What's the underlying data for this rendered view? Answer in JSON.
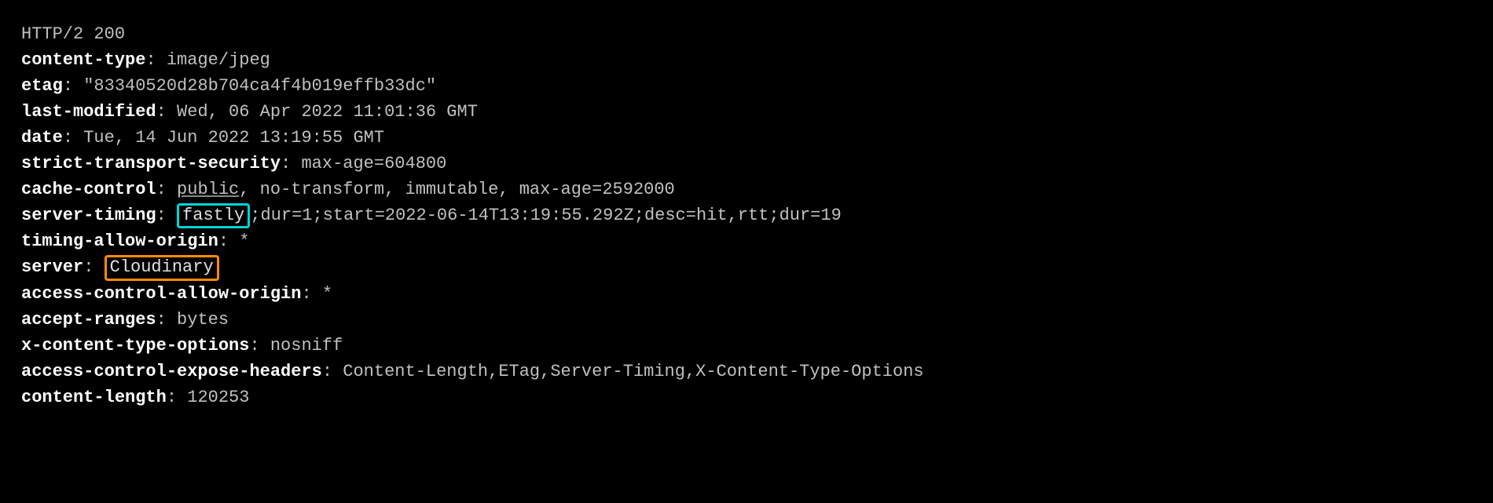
{
  "status_line": "HTTP/2 200",
  "headers": {
    "content_type": {
      "name": "content-type",
      "value": "image/jpeg"
    },
    "etag": {
      "name": "etag",
      "value": "\"83340520d28b704ca4f4b019effb33dc\""
    },
    "last_modified": {
      "name": "last-modified",
      "value": "Wed, 06 Apr 2022 11:01:36 GMT"
    },
    "date": {
      "name": "date",
      "value": "Tue, 14 Jun 2022 13:19:55 GMT"
    },
    "strict_transport_security": {
      "name": "strict-transport-security",
      "value": "max-age=604800"
    },
    "cache_control": {
      "name": "cache-control",
      "value_prefix": "public",
      "value_rest": ", no-transform, immutable, max-age=2592000"
    },
    "server_timing": {
      "name": "server-timing",
      "highlighted": "fastly",
      "value_rest": ";dur=1;start=2022-06-14T13:19:55.292Z;desc=hit,rtt;dur=19"
    },
    "timing_allow_origin": {
      "name": "timing-allow-origin",
      "value": "*"
    },
    "server": {
      "name": "server",
      "highlighted": "Cloudinary"
    },
    "access_control_allow_origin": {
      "name": "access-control-allow-origin",
      "value": "*"
    },
    "accept_ranges": {
      "name": "accept-ranges",
      "value": "bytes"
    },
    "x_content_type_options": {
      "name": "x-content-type-options",
      "value": "nosniff"
    },
    "access_control_expose_headers": {
      "name": "access-control-expose-headers",
      "value": "Content-Length,ETag,Server-Timing,X-Content-Type-Options"
    },
    "content_length": {
      "name": "content-length",
      "value": "120253"
    }
  }
}
